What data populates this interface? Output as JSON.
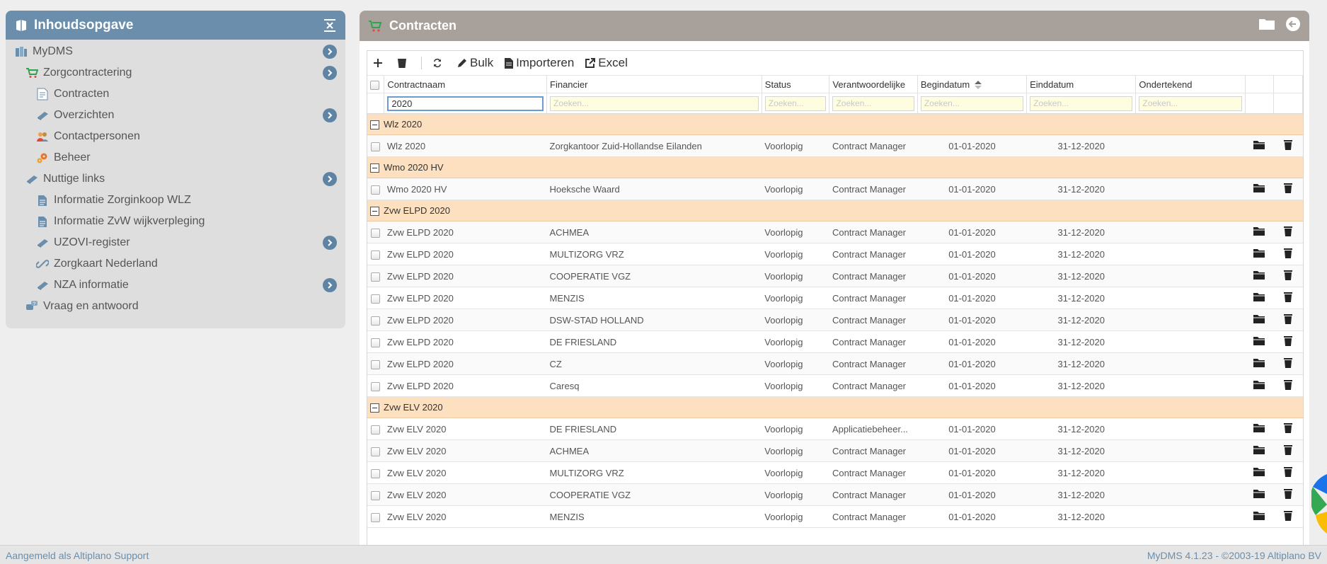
{
  "sidebar": {
    "title": "Inhoudsopgave",
    "items": [
      {
        "label": "MyDMS",
        "icon": "books-icon",
        "level": 0,
        "arrow": true
      },
      {
        "label": "Zorgcontractering",
        "icon": "cart-icon",
        "level": 1,
        "arrow": true
      },
      {
        "label": "Contracten",
        "icon": "contract-document-icon",
        "level": 2,
        "arrow": false
      },
      {
        "label": "Overzichten",
        "icon": "book-icon",
        "level": 2,
        "arrow": true
      },
      {
        "label": "Contactpersonen",
        "icon": "people-icon",
        "level": 2,
        "arrow": false
      },
      {
        "label": "Beheer",
        "icon": "gears-icon",
        "level": 2,
        "arrow": false
      },
      {
        "label": "Nuttige links",
        "icon": "book-icon",
        "level": 1,
        "arrow": true
      },
      {
        "label": "Informatie Zorginkoop WLZ",
        "icon": "document-icon",
        "level": 2,
        "arrow": false
      },
      {
        "label": "Informatie ZvW wijkverpleging",
        "icon": "document-icon",
        "level": 2,
        "arrow": false
      },
      {
        "label": "UZOVI-register",
        "icon": "book-icon",
        "level": 2,
        "arrow": true
      },
      {
        "label": "Zorgkaart Nederland",
        "icon": "link-icon",
        "level": 2,
        "arrow": false
      },
      {
        "label": "NZA informatie",
        "icon": "book-icon",
        "level": 2,
        "arrow": true
      },
      {
        "label": "Vraag en antwoord",
        "icon": "question-chat-icon",
        "level": 1,
        "arrow": false
      }
    ]
  },
  "main": {
    "title": "Contracten",
    "toolbar": {
      "bulk_label": "Bulk",
      "import_label": "Importeren",
      "excel_label": "Excel"
    },
    "columns": [
      "Contractnaam",
      "Financier",
      "Status",
      "Verantwoordelijke",
      "Begindatum",
      "Einddatum",
      "Ondertekend"
    ],
    "filters": {
      "contractnaam_value": "2020",
      "placeholder": "Zoeken..."
    },
    "groups": [
      {
        "name": "Wlz 2020",
        "rows": [
          [
            "Wlz 2020",
            "Zorgkantoor Zuid-Hollandse Eilanden",
            "Voorlopig",
            "Contract Manager",
            "01-01-2020",
            "31-12-2020"
          ]
        ]
      },
      {
        "name": "Wmo 2020 HV",
        "rows": [
          [
            "Wmo 2020 HV",
            "Hoeksche Waard",
            "Voorlopig",
            "Contract Manager",
            "01-01-2020",
            "31-12-2020"
          ]
        ]
      },
      {
        "name": "Zvw ELPD 2020",
        "rows": [
          [
            "Zvw ELPD 2020",
            "ACHMEA",
            "Voorlopig",
            "Contract Manager",
            "01-01-2020",
            "31-12-2020"
          ],
          [
            "Zvw ELPD 2020",
            "MULTIZORG VRZ",
            "Voorlopig",
            "Contract Manager",
            "01-01-2020",
            "31-12-2020"
          ],
          [
            "Zvw ELPD 2020",
            "COOPERATIE VGZ",
            "Voorlopig",
            "Contract Manager",
            "01-01-2020",
            "31-12-2020"
          ],
          [
            "Zvw ELPD 2020",
            "MENZIS",
            "Voorlopig",
            "Contract Manager",
            "01-01-2020",
            "31-12-2020"
          ],
          [
            "Zvw ELPD 2020",
            "DSW-STAD HOLLAND",
            "Voorlopig",
            "Contract Manager",
            "01-01-2020",
            "31-12-2020"
          ],
          [
            "Zvw ELPD 2020",
            "DE FRIESLAND",
            "Voorlopig",
            "Contract Manager",
            "01-01-2020",
            "31-12-2020"
          ],
          [
            "Zvw ELPD 2020",
            "CZ",
            "Voorlopig",
            "Contract Manager",
            "01-01-2020",
            "31-12-2020"
          ],
          [
            "Zvw ELPD 2020",
            "Caresq",
            "Voorlopig",
            "Contract Manager",
            "01-01-2020",
            "31-12-2020"
          ]
        ]
      },
      {
        "name": "Zvw ELV 2020",
        "rows": [
          [
            "Zvw ELV 2020",
            "DE FRIESLAND",
            "Voorlopig",
            "Applicatiebeheer...",
            "01-01-2020",
            "31-12-2020"
          ],
          [
            "Zvw ELV 2020",
            "ACHMEA",
            "Voorlopig",
            "Contract Manager",
            "01-01-2020",
            "31-12-2020"
          ],
          [
            "Zvw ELV 2020",
            "MULTIZORG VRZ",
            "Voorlopig",
            "Contract Manager",
            "01-01-2020",
            "31-12-2020"
          ],
          [
            "Zvw ELV 2020",
            "COOPERATIE VGZ",
            "Voorlopig",
            "Contract Manager",
            "01-01-2020",
            "31-12-2020"
          ],
          [
            "Zvw ELV 2020",
            "MENZIS",
            "Voorlopig",
            "Contract Manager",
            "01-01-2020",
            "31-12-2020"
          ]
        ]
      }
    ]
  },
  "footer": {
    "left": "Aangemeld als Altiplano Support",
    "right": "MyDMS 4.1.23 - ©2003-19 Altiplano BV"
  },
  "colors": {
    "sidebar_header": "#6a8eab",
    "main_header": "#a8a09a",
    "group_row": "#fde0c0",
    "arrow_bubble": "#5f84a3"
  }
}
